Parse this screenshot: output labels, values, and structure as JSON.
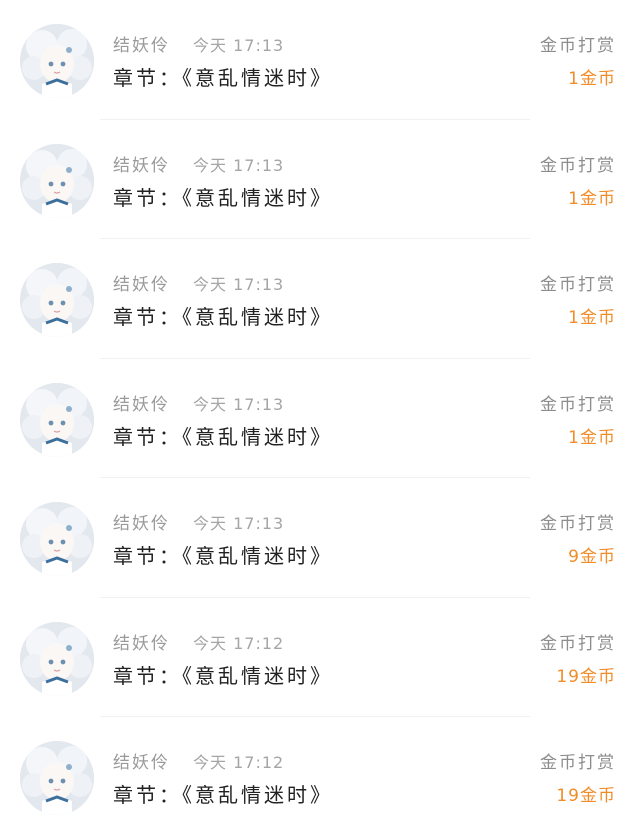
{
  "theme": {
    "amount_color": "#f28c28",
    "muted_text": "#9a9a9a",
    "main_text": "#222222"
  },
  "records": [
    {
      "avatar_icon": "user-avatar-icon",
      "username": "结妖伶",
      "time": "今天 17:13",
      "chapter": "章节：《意乱情迷时》",
      "type": "金币打赏",
      "amount": "1金币"
    },
    {
      "avatar_icon": "user-avatar-icon",
      "username": "结妖伶",
      "time": "今天 17:13",
      "chapter": "章节：《意乱情迷时》",
      "type": "金币打赏",
      "amount": "1金币"
    },
    {
      "avatar_icon": "user-avatar-icon",
      "username": "结妖伶",
      "time": "今天 17:13",
      "chapter": "章节：《意乱情迷时》",
      "type": "金币打赏",
      "amount": "1金币"
    },
    {
      "avatar_icon": "user-avatar-icon",
      "username": "结妖伶",
      "time": "今天 17:13",
      "chapter": "章节：《意乱情迷时》",
      "type": "金币打赏",
      "amount": "1金币"
    },
    {
      "avatar_icon": "user-avatar-icon",
      "username": "结妖伶",
      "time": "今天 17:13",
      "chapter": "章节：《意乱情迷时》",
      "type": "金币打赏",
      "amount": "9金币"
    },
    {
      "avatar_icon": "user-avatar-icon",
      "username": "结妖伶",
      "time": "今天 17:12",
      "chapter": "章节：《意乱情迷时》",
      "type": "金币打赏",
      "amount": "19金币"
    },
    {
      "avatar_icon": "user-avatar-icon",
      "username": "结妖伶",
      "time": "今天 17:12",
      "chapter": "章节：《意乱情迷时》",
      "type": "金币打赏",
      "amount": "19金币"
    }
  ]
}
